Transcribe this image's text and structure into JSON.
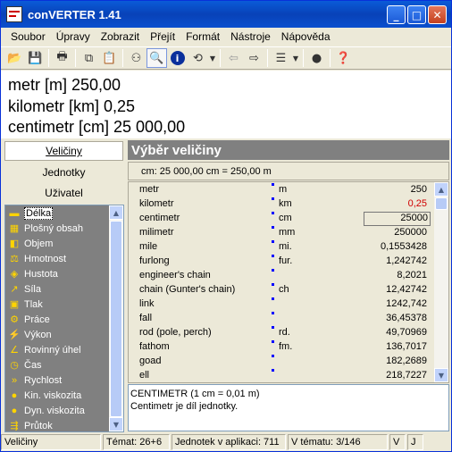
{
  "window": {
    "title": "conVERTER 1.41",
    "min": "_",
    "max": "□",
    "close": "✕"
  },
  "menu": [
    "Soubor",
    "Úpravy",
    "Zobrazit",
    "Přejít",
    "Formát",
    "Nástroje",
    "Nápověda"
  ],
  "result": {
    "line1": "metr [m] 250,00",
    "line2": "kilometr [km] 0,25",
    "line3": "centimetr [cm] 25 000,00"
  },
  "nav": {
    "veliciny": "Veličiny",
    "jednotky": "Jednotky",
    "uzivatel": "Uživatel"
  },
  "categories": [
    {
      "label": "Délka",
      "icon": "ruler-icon",
      "glyph": "▬"
    },
    {
      "label": "Plošný obsah",
      "icon": "area-icon",
      "glyph": "▦"
    },
    {
      "label": "Objem",
      "icon": "cube-icon",
      "glyph": "◧"
    },
    {
      "label": "Hmotnost",
      "icon": "weight-icon",
      "glyph": "⚖"
    },
    {
      "label": "Hustota",
      "icon": "density-icon",
      "glyph": "◈"
    },
    {
      "label": "Síla",
      "icon": "force-icon",
      "glyph": "↗"
    },
    {
      "label": "Tlak",
      "icon": "pressure-icon",
      "glyph": "▣"
    },
    {
      "label": "Práce",
      "icon": "gear-icon",
      "glyph": "⚙"
    },
    {
      "label": "Výkon",
      "icon": "power-icon",
      "glyph": "⚡"
    },
    {
      "label": "Rovinný úhel",
      "icon": "angle-icon",
      "glyph": "∠"
    },
    {
      "label": "Čas",
      "icon": "clock-icon",
      "glyph": "◷"
    },
    {
      "label": "Rychlost",
      "icon": "speed-icon",
      "glyph": "»"
    },
    {
      "label": "Kin. viskozita",
      "icon": "drop-icon",
      "glyph": "●"
    },
    {
      "label": "Dyn. viskozita",
      "icon": "drops-icon",
      "glyph": "●"
    },
    {
      "label": "Průtok",
      "icon": "flow-icon",
      "glyph": "⇶"
    }
  ],
  "panel": {
    "title": "Výběr veličiny",
    "formula": "cm: 25 000,00 cm = 250,00 m"
  },
  "units": [
    {
      "name": "metr",
      "abbr": "m",
      "value": "250"
    },
    {
      "name": "kilometr",
      "abbr": "km",
      "value": "0,25"
    },
    {
      "name": "centimetr",
      "abbr": "cm",
      "value": "25000"
    },
    {
      "name": "milimetr",
      "abbr": "mm",
      "value": "250000"
    },
    {
      "name": "mile",
      "abbr": "mi.",
      "value": "0,1553428"
    },
    {
      "name": "furlong",
      "abbr": "fur.",
      "value": "1,242742"
    },
    {
      "name": "engineer's chain",
      "abbr": "",
      "value": "8,2021"
    },
    {
      "name": "chain (Gunter's chain)",
      "abbr": "ch",
      "value": "12,42742"
    },
    {
      "name": "link",
      "abbr": "",
      "value": "1242,742"
    },
    {
      "name": "fall",
      "abbr": "",
      "value": "36,45378"
    },
    {
      "name": "rod (pole, perch)",
      "abbr": "rd.",
      "value": "49,70969"
    },
    {
      "name": "fathom",
      "abbr": "fm.",
      "value": "136,7017"
    },
    {
      "name": "goad",
      "abbr": "",
      "value": "182,2689"
    },
    {
      "name": "ell",
      "abbr": "",
      "value": "218,7227"
    }
  ],
  "description": {
    "line1": "CENTIMETR (1 cm = 0,01 m)",
    "line2": "Centimetr je díl jednotky."
  },
  "status": {
    "cell1": "Veličiny",
    "cell2": "Témat: 26+6",
    "cell3": "Jednotek v aplikaci: 711",
    "cell4": "V tématu: 3/146",
    "cell5": "V",
    "cell6": "J"
  },
  "colors": {
    "titlebar": "#0842b8",
    "highlight": "#d00000",
    "panel_head": "#808080"
  }
}
